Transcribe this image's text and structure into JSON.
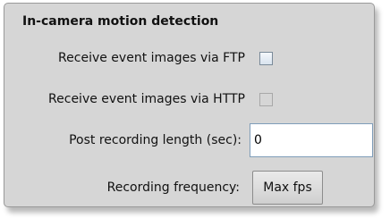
{
  "section": {
    "title": "In-camera motion detection"
  },
  "ftp": {
    "label": "Receive event images via FTP",
    "checked": false,
    "enabled": true
  },
  "http": {
    "label": "Receive event images via HTTP",
    "checked": false,
    "enabled": false
  },
  "post_recording": {
    "label": "Post recording length (sec):",
    "value": "0"
  },
  "recording_frequency": {
    "label": "Recording frequency:",
    "button_label": "Max fps"
  },
  "colors": {
    "panel_background": "#d6d6d6",
    "text": "#111111",
    "input_border": "#7f9db9"
  }
}
